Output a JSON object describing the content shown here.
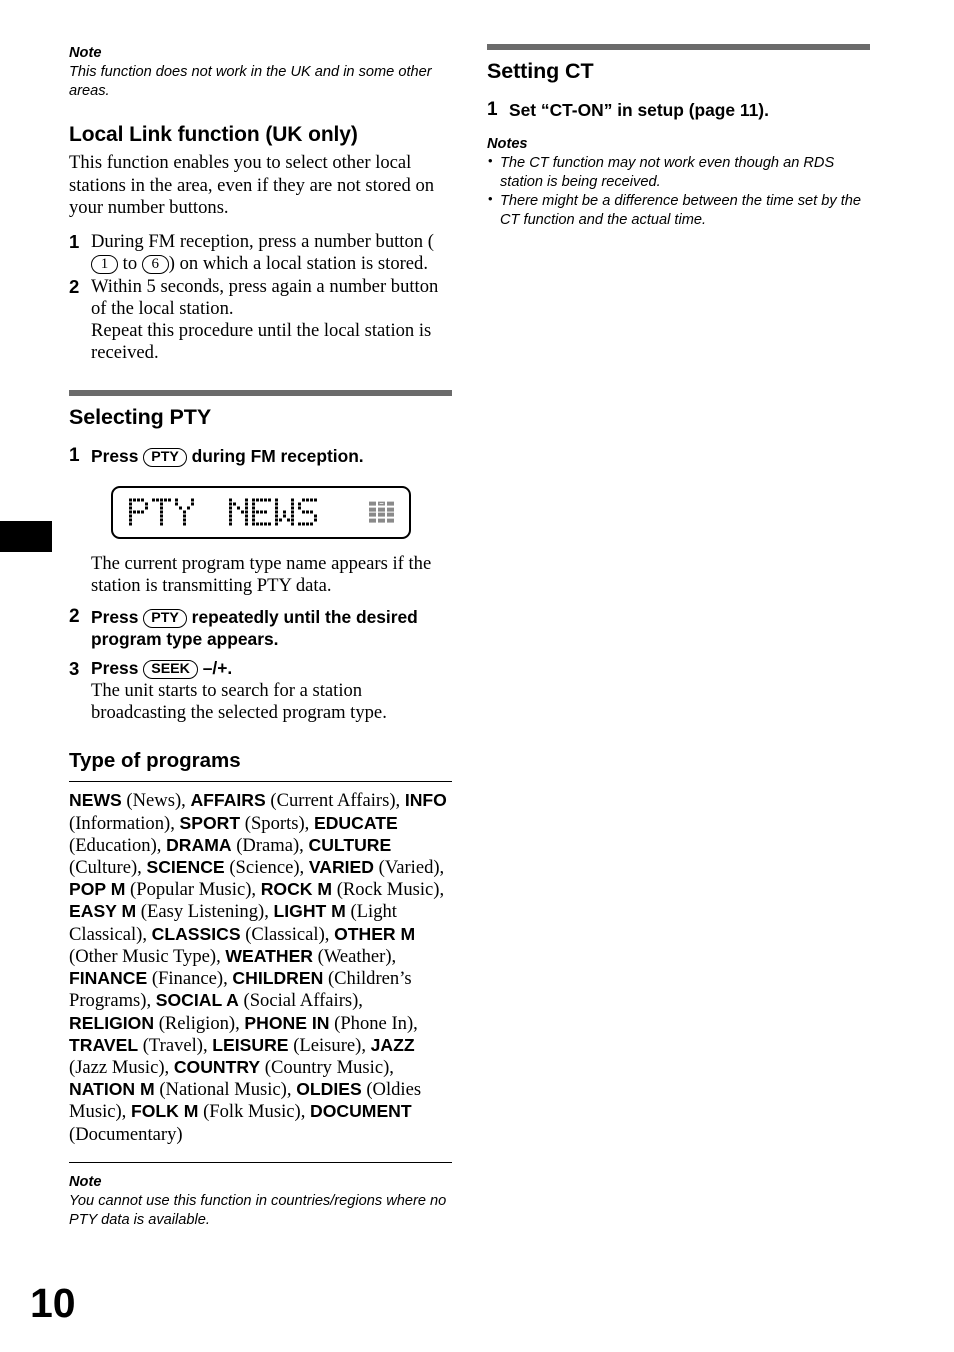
{
  "page": {
    "number": "10",
    "accent_rule_color": "#6b6b6b"
  },
  "left_column": {
    "top_note": {
      "title": "Note",
      "body": "This function does not work in the UK and in some other areas."
    },
    "local_link": {
      "heading": "Local Link function (UK only)",
      "intro": "This function enables you to select other local stations in the area, even if they are not stored on your number buttons.",
      "steps": [
        {
          "num": "1",
          "text_before": "During FM reception, press a number button (",
          "key_a": "1",
          "text_mid": "to",
          "key_b": "6",
          "text_after": ") on which a local station is stored."
        },
        {
          "num": "2",
          "line1": "Within 5 seconds, press again a number button of the local station.",
          "line2": "Repeat this procedure until the local station is received."
        }
      ]
    },
    "selecting_pty": {
      "heading": "Selecting PTY",
      "step1": {
        "num": "1",
        "text_before": "Press",
        "key": "PTY",
        "text_after": "during FM reception."
      },
      "display": {
        "left_text": "PTY",
        "main_text": "NEWS",
        "icon": "level-grid-icon"
      },
      "step1_caption": "The current program type name appears if the station is transmitting PTY data.",
      "step2": {
        "num": "2",
        "text_before": "Press",
        "key": "PTY",
        "text_after": "repeatedly until the desired program type appears."
      },
      "step3": {
        "num": "3",
        "text_before": "Press",
        "key": "SEEK",
        "text_after": "–/+.",
        "caption": "The unit starts to search for a station broadcasting the selected program type."
      }
    },
    "type_of_programs": {
      "heading": "Type of programs",
      "items": [
        {
          "code": "NEWS",
          "desc": "(News)"
        },
        {
          "code": "AFFAIRS",
          "desc": "(Current Affairs)"
        },
        {
          "code": "INFO",
          "desc": "(Information)"
        },
        {
          "code": "SPORT",
          "desc": "(Sports)"
        },
        {
          "code": "EDUCATE",
          "desc": "(Education)"
        },
        {
          "code": "DRAMA",
          "desc": "(Drama)"
        },
        {
          "code": "CULTURE",
          "desc": "(Culture)"
        },
        {
          "code": "SCIENCE",
          "desc": "(Science)"
        },
        {
          "code": "VARIED",
          "desc": "(Varied)"
        },
        {
          "code": "POP M",
          "desc": "(Popular Music)"
        },
        {
          "code": "ROCK M",
          "desc": "(Rock Music)"
        },
        {
          "code": "EASY M",
          "desc": "(Easy Listening)"
        },
        {
          "code": "LIGHT M",
          "desc": "(Light Classical)"
        },
        {
          "code": "CLASSICS",
          "desc": "(Classical)"
        },
        {
          "code": "OTHER M",
          "desc": "(Other Music Type)"
        },
        {
          "code": "WEATHER",
          "desc": "(Weather)"
        },
        {
          "code": "FINANCE",
          "desc": "(Finance)"
        },
        {
          "code": "CHILDREN",
          "desc": "(Children’s Programs)"
        },
        {
          "code": "SOCIAL A",
          "desc": "(Social Affairs)"
        },
        {
          "code": "RELIGION",
          "desc": "(Religion)"
        },
        {
          "code": "PHONE IN",
          "desc": "(Phone In)"
        },
        {
          "code": "TRAVEL",
          "desc": "(Travel)"
        },
        {
          "code": "LEISURE",
          "desc": "(Leisure)"
        },
        {
          "code": "JAZZ",
          "desc": "(Jazz Music)"
        },
        {
          "code": "COUNTRY",
          "desc": "(Country Music)"
        },
        {
          "code": "NATION M",
          "desc": "(National Music)"
        },
        {
          "code": "OLDIES",
          "desc": "(Oldies Music)"
        },
        {
          "code": "FOLK M",
          "desc": "(Folk Music)"
        },
        {
          "code": "DOCUMENT",
          "desc": "(Documentary)"
        }
      ]
    },
    "bottom_note": {
      "title": "Note",
      "body": "You cannot use this function in countries/regions where no PTY data is available."
    }
  },
  "right_column": {
    "setting_ct": {
      "heading": "Setting CT",
      "step1": {
        "num": "1",
        "text": "Set “CT-ON” in setup (page 11)."
      },
      "notes_title": "Notes",
      "notes": [
        "The CT function may not work even though an RDS station is being received.",
        "There might be a difference between the time set by the CT function and the actual time."
      ]
    }
  }
}
